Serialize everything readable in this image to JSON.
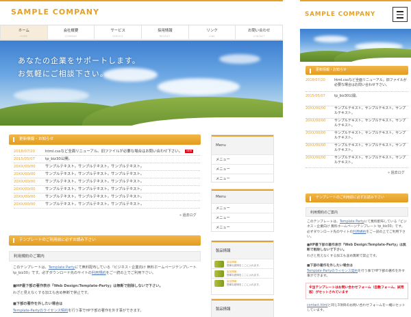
{
  "desktop": {
    "logo": "SAMPLE COMPANY",
    "nav": [
      {
        "jp": "ホーム",
        "en": "HOME"
      },
      {
        "jp": "会社概要",
        "en": "COMPANY"
      },
      {
        "jp": "サービス",
        "en": "SERVICE"
      },
      {
        "jp": "採用情報",
        "en": "RECRUIT"
      },
      {
        "jp": "リンク",
        "en": "LINK"
      },
      {
        "jp": "お問い合わせ",
        "en": "CONTACT"
      }
    ],
    "hero": {
      "line1": "あなたの企業をサポートします。",
      "line2": "お気軽にご相談下さい。"
    },
    "news": {
      "heading": "更新情報・お知らせ",
      "items": [
        {
          "date": "2018/07/20",
          "text": "html.cssなど全面リニューアル。旧ファイルが必要な場合はお問い合わせ下さい。",
          "new": "NEW"
        },
        {
          "date": "2015/05/07",
          "text": "tp_biz30公開。"
        },
        {
          "date": "20XX/00/00",
          "text": "サンプルテキスト。サンプルテキスト。サンプルテキスト。"
        },
        {
          "date": "20XX/00/00",
          "text": "サンプルテキスト。サンプルテキスト。サンプルテキスト。"
        },
        {
          "date": "20XX/00/00",
          "text": "サンプルテキスト。サンプルテキスト。サンプルテキスト。"
        },
        {
          "date": "20XX/00/00",
          "text": "サンプルテキスト。サンプルテキスト。サンプルテキスト。"
        },
        {
          "date": "20XX/00/00",
          "text": "サンプルテキスト。サンプルテキスト。サンプルテキスト。"
        },
        {
          "date": "20XX/00/00",
          "text": "サンプルテキスト。サンプルテキスト。サンプルテキスト。"
        }
      ],
      "more": "» 過去ログ"
    },
    "template": {
      "heading": "テンプレートのご利用前に必ずお読み下さい",
      "sub": "利用規約のご案内",
      "p1a": "このテンプレートは、",
      "p1link": "Template Party",
      "p1b": "にて無料配布している『ビジネス・企業向け 無料ホームページテンプレート tp_biz30』です。必ずダウンロード先のサイトの",
      "p1link2": "利用規約",
      "p1c": "をご一読の上でご利用下さい。",
      "warn1": "■HP最下部の著作表示『Web Design:Template-Party』は無断で削除しないで下さい。",
      "warn1sub": "わざと見えなくする加工も含め無断で禁止です。",
      "warn2": "■下部の著作を外したい場合は",
      "p2link": "Template-Party",
      "p2link2": "のライセンス契約",
      "p2b": "を行う事でHP下部の著作を外す事ができます。"
    },
    "side": {
      "menu1": {
        "title": "Menu",
        "items": [
          "メニュー",
          "メニュー",
          "メニュー"
        ]
      },
      "menu2": {
        "title": "Menu",
        "items": [
          "メニュー",
          "メニュー",
          "メニュー"
        ]
      },
      "products": {
        "title": "製品情報",
        "items": [
          {
            "name": "製品情報",
            "desc": "簡単な説明をここに入れます。"
          },
          {
            "name": "製品情報",
            "desc": "簡単な説明をここに入れます。"
          },
          {
            "name": "製品情報",
            "desc": "簡単な説明をここに入れます。"
          }
        ]
      },
      "lower": {
        "title": "製品情報"
      }
    }
  },
  "mobile": {
    "logo": "SAMPLE COMPANY",
    "menu_icon": "hamburger-icon",
    "news": {
      "heading": "更新情報・お知らせ",
      "items": [
        {
          "date": "2018/07/20",
          "text": "html.cssなど全面リニューアル。旧ファイルが必要な場合はお問い合わせ下さい。"
        },
        {
          "date": "2015/05/07",
          "text": "tp_biz30公開。"
        },
        {
          "date": "20XX/00/00",
          "text": "サンプルテキスト。サンプルテキスト。サンプルテキスト。"
        },
        {
          "date": "20XX/00/00",
          "text": "サンプルテキスト。サンプルテキスト。サンプルテキスト。"
        },
        {
          "date": "20XX/00/00",
          "text": "サンプルテキスト。サンプルテキスト。サンプルテキスト。"
        },
        {
          "date": "20XX/00/00",
          "text": "サンプルテキスト。サンプルテキスト。サンプルテキスト。"
        },
        {
          "date": "20XX/00/00",
          "text": "サンプルテキスト。サンプルテキスト。サンプルテキスト。"
        }
      ],
      "more": "» 過去ログ"
    },
    "template": {
      "heading": "テンプレートのご利用前に必ずお読み下さい",
      "sub": "利用規約のご案内",
      "p1a": "このテンプレートは、",
      "p1link": "Template Party",
      "p1b": "にて無料配布している『ビジネス・企業向け 無料ホームページテンプレート tp_biz30』です。必ずダウンロード先のサイトの",
      "p1link2": "利用規約",
      "p1c": "をご一読の上でご利用下さい。",
      "warn1": "■HP最下部の著作表示『Web Design:Template-Party』は無断で削除しないで下さい。",
      "warn1sub": "わざと見えなくする加工も含め無断で禁止です。",
      "warn2": "■下部の著作を外したい場合は",
      "p2link": "Template-Party",
      "p2link2": "のライセンス契約",
      "p2b": "を行う事でHP下部の著作を外す事ができます。",
      "boxline": "※当テンプレートはお問い合わせフォーム（自動フォーム、試用版）がセットされています",
      "p3link": "contact.html",
      "p3b": "と同じ3項目のお問い合わせフォームを一緒にセットしています。"
    }
  },
  "colors": {
    "accent": "#e3a12a",
    "red": "#e60012",
    "link": "#4b76b8"
  }
}
